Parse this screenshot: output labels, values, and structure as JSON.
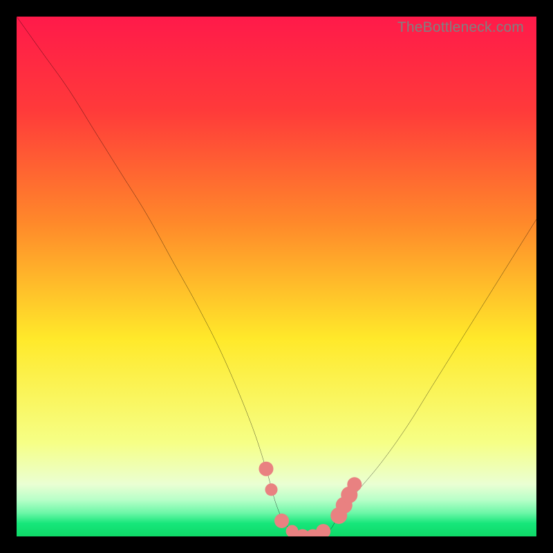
{
  "watermark": "TheBottleneck.com",
  "colors": {
    "top": "#ff1a4a",
    "mid_upper": "#ff8a2a",
    "mid": "#ffe92a",
    "mid_lower": "#f6ff86",
    "pale": "#eaffd3",
    "green": "#16e67a",
    "curve": "#000000",
    "marker": "#e98181",
    "border": "#000000"
  },
  "chart_data": {
    "type": "line",
    "title": "",
    "xlabel": "",
    "ylabel": "",
    "xlim": [
      0,
      100
    ],
    "ylim": [
      0,
      100
    ],
    "series": [
      {
        "name": "bottleneck-curve",
        "x": [
          0,
          5,
          10,
          15,
          20,
          25,
          30,
          35,
          40,
          45,
          48,
          50,
          52,
          55,
          57,
          60,
          62,
          65,
          70,
          75,
          80,
          85,
          90,
          95,
          100
        ],
        "y": [
          100,
          93,
          86,
          78,
          70,
          62,
          53,
          44,
          34,
          22,
          13,
          6,
          2,
          0,
          0,
          1,
          4,
          8,
          14,
          21,
          29,
          37,
          45,
          53,
          61
        ]
      }
    ],
    "markers": {
      "name": "highlighted-points",
      "points": [
        {
          "x": 48,
          "y": 13,
          "r": 1.4
        },
        {
          "x": 49,
          "y": 9,
          "r": 1.2
        },
        {
          "x": 51,
          "y": 3,
          "r": 1.4
        },
        {
          "x": 53,
          "y": 1,
          "r": 1.2
        },
        {
          "x": 55,
          "y": 0,
          "r": 1.4
        },
        {
          "x": 57,
          "y": 0,
          "r": 1.4
        },
        {
          "x": 59,
          "y": 1,
          "r": 1.4
        },
        {
          "x": 62,
          "y": 4,
          "r": 1.6
        },
        {
          "x": 63,
          "y": 6,
          "r": 1.6
        },
        {
          "x": 64,
          "y": 8,
          "r": 1.6
        },
        {
          "x": 65,
          "y": 10,
          "r": 1.4
        }
      ]
    },
    "gradient_stops": [
      {
        "pos": 0.0,
        "color": "#ff1a4a"
      },
      {
        "pos": 0.18,
        "color": "#ff3a3a"
      },
      {
        "pos": 0.4,
        "color": "#ff8a2a"
      },
      {
        "pos": 0.62,
        "color": "#ffe92a"
      },
      {
        "pos": 0.82,
        "color": "#f6ff86"
      },
      {
        "pos": 0.9,
        "color": "#eaffd3"
      },
      {
        "pos": 0.93,
        "color": "#b7ffc8"
      },
      {
        "pos": 0.955,
        "color": "#6cf7a7"
      },
      {
        "pos": 0.975,
        "color": "#16e67a"
      },
      {
        "pos": 1.0,
        "color": "#0fd968"
      }
    ]
  }
}
